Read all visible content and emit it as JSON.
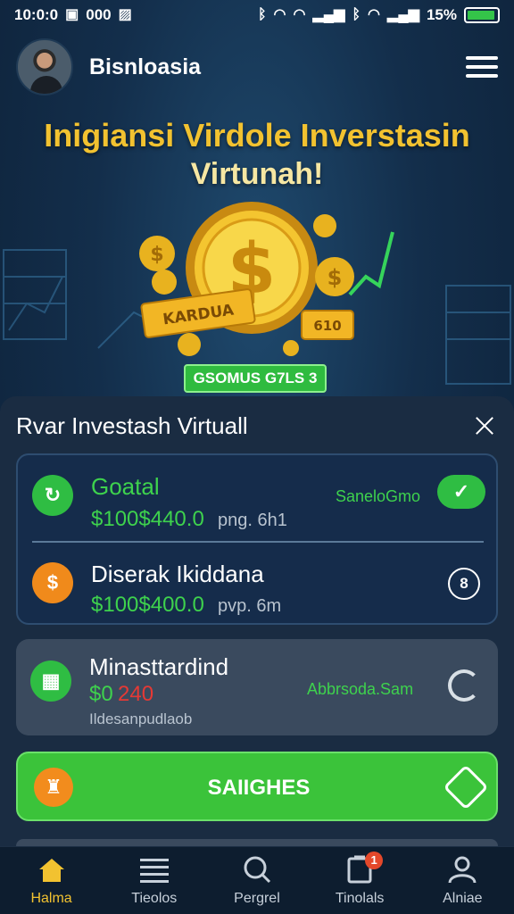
{
  "status_bar": {
    "time": "10:0:0",
    "left_text": "000",
    "battery_text": "15%",
    "battery_level": 0.95
  },
  "header": {
    "app_title": "Bisnloasia"
  },
  "hero": {
    "title": "Inigiansi Virdole Inverstasin",
    "subtitle": "Virtunah!",
    "banner_label": "KARDUA",
    "coin_label": "610",
    "badge": "GSOMUS G7LS 3"
  },
  "panel": {
    "title": "Rvar Investash Virtuall",
    "rows": [
      {
        "title": "Goatal",
        "amount": "$100$440.0",
        "amount_suffix": "png. 6h1",
        "status": "SaneloGmo",
        "icon": "refresh-dollar-icon",
        "action_icon": "check-icon"
      },
      {
        "title": "Diserak Ikiddana",
        "amount": "$100$400.0",
        "amount_suffix": "pvp. 6m",
        "icon_glyph": "$",
        "action_glyph": "8",
        "icon": "dollar-coin-icon"
      }
    ],
    "card3": {
      "title": "Minasttardind",
      "amount_green": "$0",
      "amount_red": "240",
      "status": "Abbrsoda.Sam",
      "note": "Ildesanpudlaob",
      "icon": "calculator-icon",
      "action_icon": "refresh-icon"
    },
    "cta": {
      "label": "SAIIGHES",
      "left_icon": "trophy-icon",
      "right_icon": "diamond-icon"
    }
  },
  "nav": {
    "items": [
      {
        "label": "Halma",
        "icon": "home-icon",
        "active": true
      },
      {
        "label": "Tieolos",
        "icon": "list-icon",
        "active": false
      },
      {
        "label": "Pergrel",
        "icon": "search-icon",
        "active": false
      },
      {
        "label": "Tinolals",
        "icon": "clipboard-icon",
        "active": false,
        "badge": "1"
      },
      {
        "label": "Alniae",
        "icon": "user-icon",
        "active": false
      }
    ]
  },
  "colors": {
    "accent_green": "#3ed24d",
    "accent_gold": "#f2c230",
    "background": "#132e4b"
  }
}
